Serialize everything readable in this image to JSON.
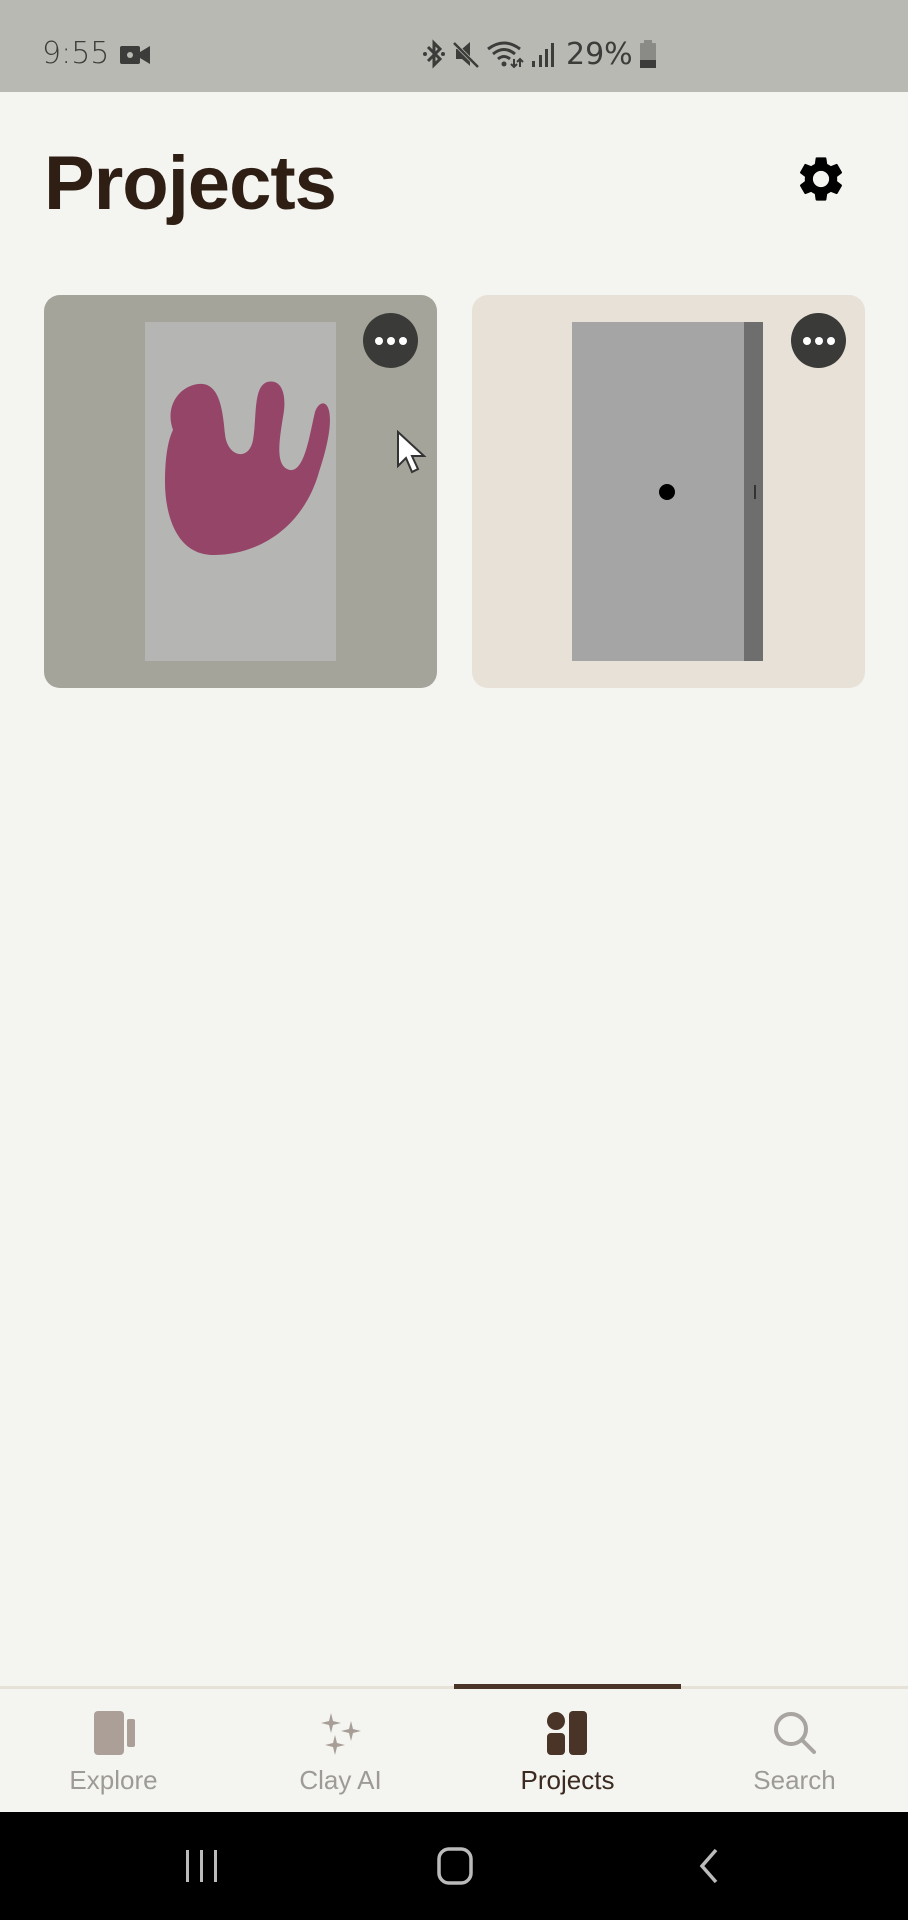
{
  "status_bar": {
    "time": "9:55",
    "battery_percent": "29%",
    "icons": [
      "video-camera-icon",
      "bluetooth-icon",
      "mute-icon",
      "wifi-icon",
      "signal-icon",
      "battery-icon"
    ]
  },
  "header": {
    "title": "Projects",
    "settings_icon": "gear-icon"
  },
  "projects": [
    {
      "name": "project-card-1",
      "background": "#a4a49a",
      "thumbnail_bg": "#b5b6b4",
      "shape_color": "#954668",
      "more_icon": "more-horizontal-icon"
    },
    {
      "name": "project-card-2",
      "background": "#e8e1d7",
      "thumbnail_bg": "#a5a5a5",
      "more_icon": "more-horizontal-icon"
    }
  ],
  "tabs": [
    {
      "label": "Explore",
      "icon": "explore-icon",
      "active": false
    },
    {
      "label": "Clay AI",
      "icon": "sparkles-icon",
      "active": false
    },
    {
      "label": "Projects",
      "icon": "projects-icon",
      "active": true
    },
    {
      "label": "Search",
      "icon": "search-icon",
      "active": false
    }
  ],
  "colors": {
    "accent": "#4a3428",
    "inactive": "#9e9b96",
    "title": "#2e1e14"
  },
  "system_nav": [
    "recents-button",
    "home-button",
    "back-button"
  ]
}
